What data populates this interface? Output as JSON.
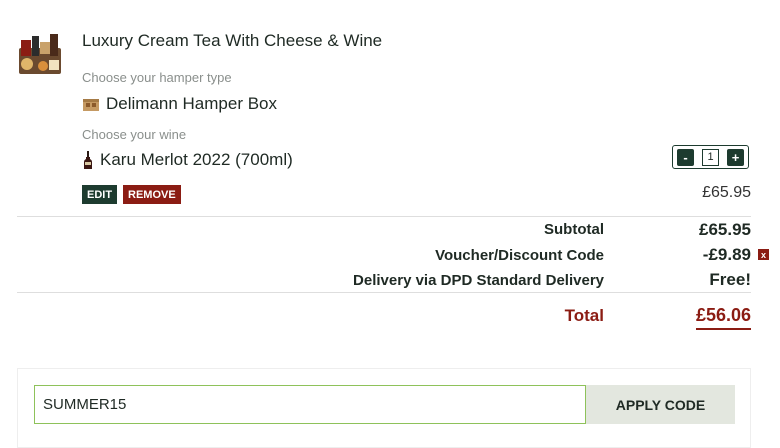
{
  "item": {
    "title": "Luxury Cream Tea With Cheese & Wine",
    "hamper_label": "Choose your hamper type",
    "hamper_value": "Delimann Hamper Box",
    "wine_label": "Choose your wine",
    "wine_value": "Karu Merlot 2022 (700ml)",
    "edit_label": "EDIT",
    "remove_label": "REMOVE",
    "price": "£65.95",
    "quantity": "1",
    "minus": "-",
    "plus": "+"
  },
  "summary": {
    "subtotal_label": "Subtotal",
    "subtotal_value": "£65.95",
    "voucher_label": "Voucher/Discount Code",
    "voucher_value": "-£9.89",
    "voucher_remove": "x",
    "delivery_label": "Delivery via DPD Standard Delivery",
    "delivery_value": "Free!",
    "total_label": "Total",
    "total_value": "£56.06"
  },
  "voucher": {
    "code": "SUMMER15",
    "apply_label": "APPLY CODE"
  },
  "colors": {
    "brand_green": "#1d3b2f",
    "accent_red": "#8b1c13",
    "input_border": "#8ec25a"
  }
}
